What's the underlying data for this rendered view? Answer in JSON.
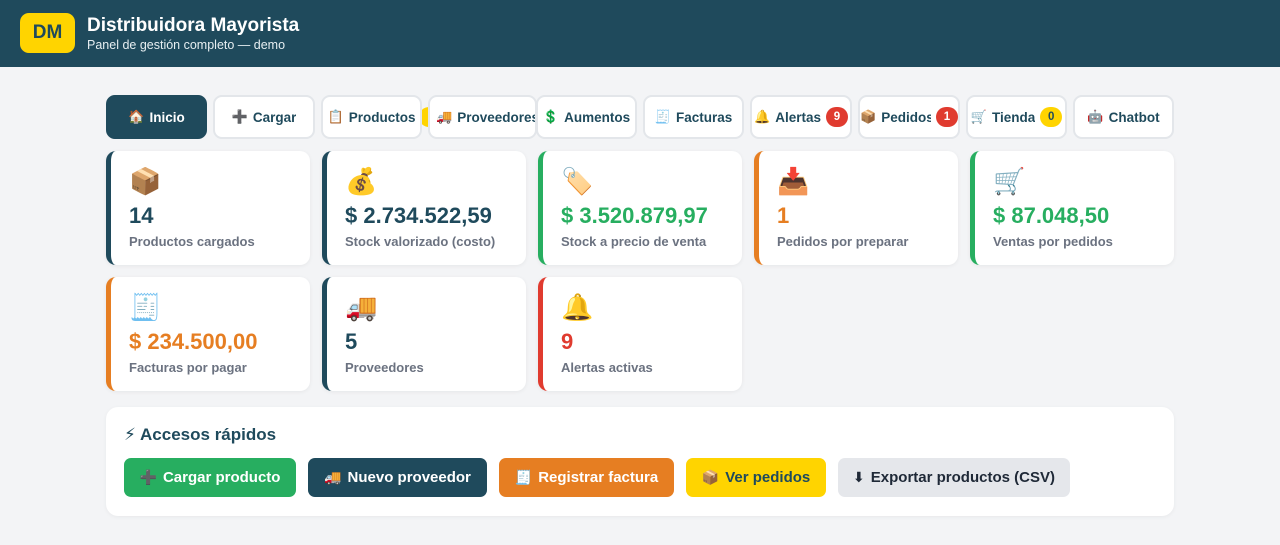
{
  "header": {
    "logo": "DM",
    "title": "Distribuidora Mayorista",
    "subtitle": "Panel de gestión completo — demo"
  },
  "tabs": [
    {
      "icon": "🏠",
      "label": "Inicio",
      "active": true
    },
    {
      "icon": "➕",
      "label": "Cargar"
    },
    {
      "icon": "📋",
      "label": "Productos"
    },
    {
      "icon": "🚚",
      "label": "Proveedores"
    },
    {
      "icon": "💲",
      "label": "Aumentos"
    },
    {
      "icon": "🧾",
      "label": "Facturas"
    },
    {
      "icon": "🔔",
      "label": "Alertas",
      "badge": "9",
      "badge_color": "#e03b2f"
    },
    {
      "icon": "📦",
      "label": "Pedidos",
      "badge": "1",
      "badge_color": "#e03b2f"
    },
    {
      "icon": "🛒",
      "label": "Tienda",
      "badge": "0",
      "badge_color": "#ffd400"
    },
    {
      "icon": "🤖",
      "label": "Chatbot"
    }
  ],
  "cards": [
    {
      "icon": "📦",
      "value": "14",
      "label": "Productos cargados",
      "accent": "#1f4a5c",
      "value_color": "#1f4a5c"
    },
    {
      "icon": "💰",
      "value": "$ 2.734.522,59",
      "label": "Stock valorizado (costo)",
      "accent": "#1f4a5c",
      "value_color": "#1f4a5c"
    },
    {
      "icon": "🏷️",
      "value": "$ 3.520.879,97",
      "label": "Stock a precio de venta",
      "accent": "#27ae60",
      "value_color": "#27ae60"
    },
    {
      "icon": "📥",
      "value": "1",
      "label": "Pedidos por preparar",
      "accent": "#e67e22",
      "value_color": "#e67e22"
    },
    {
      "icon": "🛒",
      "value": "$ 87.048,50",
      "label": "Ventas por pedidos",
      "accent": "#27ae60",
      "value_color": "#27ae60"
    },
    {
      "icon": "🧾",
      "value": "$ 234.500,00",
      "label": "Facturas por pagar",
      "accent": "#e67e22",
      "value_color": "#e67e22"
    },
    {
      "icon": "🚚",
      "value": "5",
      "label": "Proveedores",
      "accent": "#1f4a5c",
      "value_color": "#1f4a5c"
    },
    {
      "icon": "🔔",
      "value": "9",
      "label": "Alertas activas",
      "accent": "#e03b2f",
      "value_color": "#e03b2f"
    }
  ],
  "quick_access": {
    "icon": "⚡",
    "title": "Accesos rápidos",
    "buttons": [
      {
        "icon": "➕",
        "label": "Cargar producto",
        "bg": "#27ae60",
        "fg": "#ffffff"
      },
      {
        "icon": "🚚",
        "label": "Nuevo proveedor",
        "bg": "#1f4a5c",
        "fg": "#ffffff"
      },
      {
        "icon": "🧾",
        "label": "Registrar factura",
        "bg": "#e67e22",
        "fg": "#ffffff"
      },
      {
        "icon": "📦",
        "label": "Ver pedidos",
        "bg": "#ffd400",
        "fg": "#1f4a5c"
      },
      {
        "icon": "⬇",
        "label": "Exportar productos (CSV)",
        "bg": "#e5e7eb",
        "fg": "#1f2937"
      }
    ]
  }
}
